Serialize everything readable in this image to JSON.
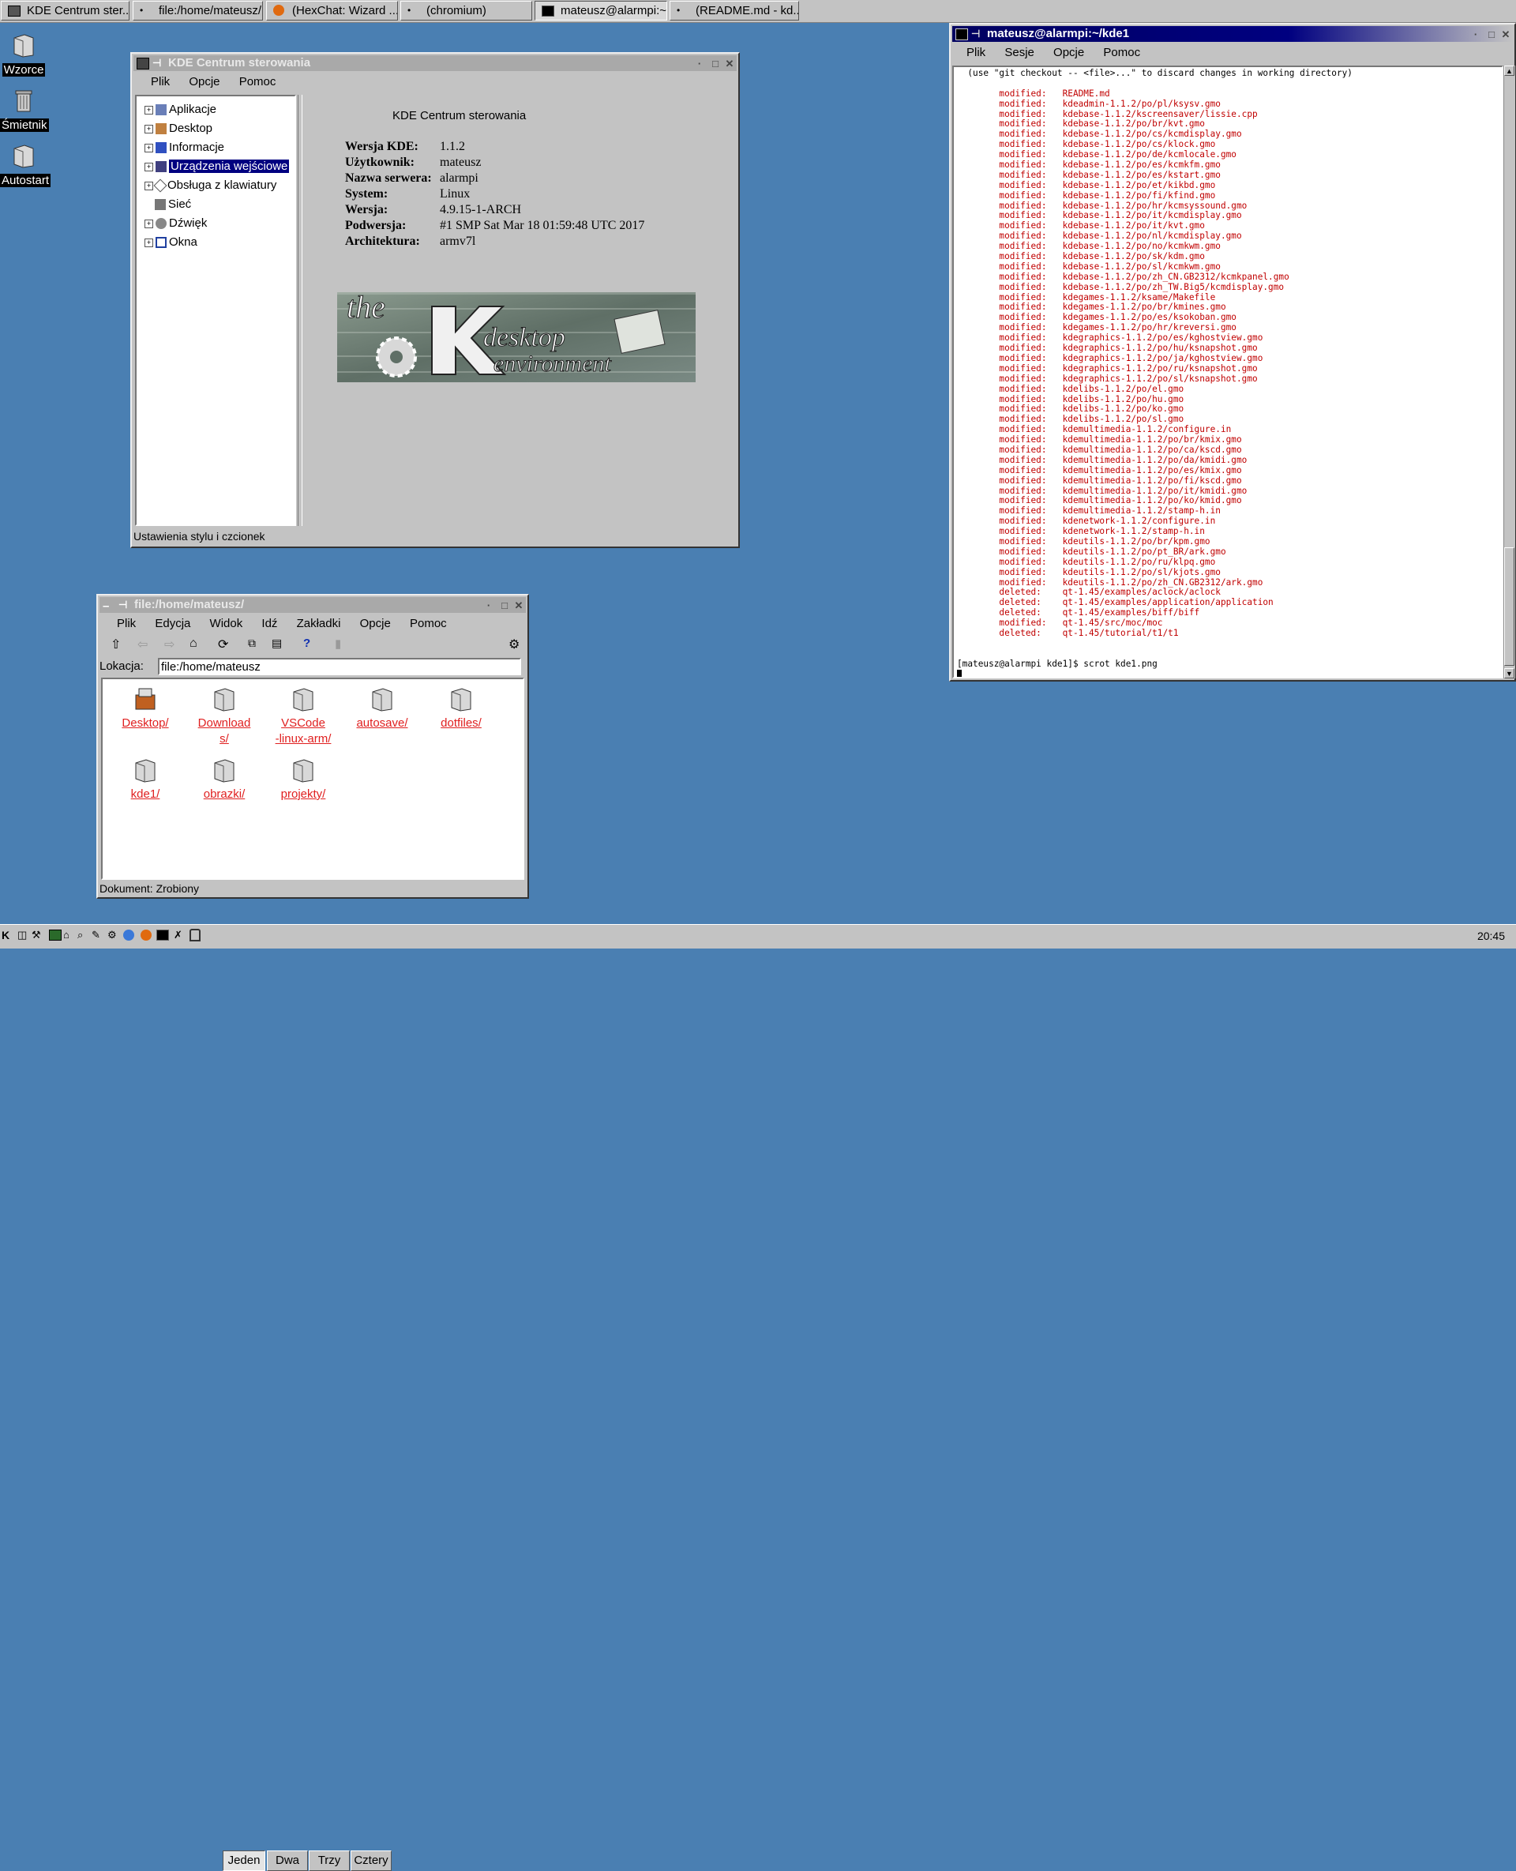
{
  "taskbar": {
    "tasks": [
      {
        "label": "KDE Centrum ster...",
        "icon": "kde-control-icon"
      },
      {
        "label": "file:/home/mateusz/",
        "icon": "dot-icon"
      },
      {
        "label": "(HexChat: Wizard ...",
        "icon": "hexchat-icon"
      },
      {
        "label": "(chromium)",
        "icon": "dot-icon"
      },
      {
        "label": "mateusz@alarmpi:~/...",
        "icon": "terminal-icon"
      },
      {
        "label": "(README.md - kd...",
        "icon": "dot-icon"
      }
    ]
  },
  "desktop_icons": [
    {
      "label": "Wzorce",
      "icon": "folder-icon"
    },
    {
      "label": "Śmietnik",
      "icon": "trash-icon"
    },
    {
      "label": "Autostart",
      "icon": "folder-icon"
    }
  ],
  "kcontrol": {
    "title": "KDE Centrum sterowania",
    "menu": [
      "Plik",
      "Opcje",
      "Pomoc"
    ],
    "tree": [
      {
        "label": "Aplikacje"
      },
      {
        "label": "Desktop"
      },
      {
        "label": "Informacje"
      },
      {
        "label": "Urządzenia wejściowe",
        "selected": true
      },
      {
        "label": "Obsługa z klawiatury"
      },
      {
        "label": "Sieć"
      },
      {
        "label": "Dźwięk"
      },
      {
        "label": "Okna"
      }
    ],
    "heading": "KDE Centrum sterowania",
    "info": [
      {
        "key": "Wersja KDE:",
        "value": "1.1.2"
      },
      {
        "key": "Użytkownik:",
        "value": "mateusz"
      },
      {
        "key": "Nazwa serwera:",
        "value": "alarmpi"
      },
      {
        "key": "System:",
        "value": "Linux"
      },
      {
        "key": "Wersja:",
        "value": "4.9.15-1-ARCH"
      },
      {
        "key": "Podwersja:",
        "value": "#1 SMP Sat Mar 18 01:59:48 UTC 2017"
      },
      {
        "key": "Architektura:",
        "value": "armv7l"
      }
    ],
    "banner": {
      "the": "the",
      "k": "K",
      "desktop": "desktop",
      "environment": "environment"
    },
    "status": "Ustawienia stylu i czcionek"
  },
  "filemanager": {
    "title": "file:/home/mateusz/",
    "menu": [
      "Plik",
      "Edycja",
      "Widok",
      "Idź",
      "Zakładki",
      "Opcje",
      "Pomoc"
    ],
    "location_label": "Lokacja:",
    "location_value": "file:/home/mateusz",
    "items": [
      {
        "label": "Desktop/"
      },
      {
        "label": "Download\ns/"
      },
      {
        "label": "VSCode\n-linux-arm/"
      },
      {
        "label": "autosave/"
      },
      {
        "label": "dotfiles/"
      },
      {
        "label": "kde1/"
      },
      {
        "label": "obrazki/"
      },
      {
        "label": "projekty/"
      }
    ],
    "status": "Dokument: Zrobiony"
  },
  "terminal": {
    "title": "mateusz@alarmpi:~/kde1",
    "menu": [
      "Plik",
      "Sesje",
      "Opcje",
      "Pomoc"
    ],
    "header_line": "  (use \"git checkout -- <file>...\" to discard changes in working directory)",
    "lines": [
      "        modified:   README.md",
      "        modified:   kdeadmin-1.1.2/po/pl/ksysv.gmo",
      "        modified:   kdebase-1.1.2/kscreensaver/lissie.cpp",
      "        modified:   kdebase-1.1.2/po/br/kvt.gmo",
      "        modified:   kdebase-1.1.2/po/cs/kcmdisplay.gmo",
      "        modified:   kdebase-1.1.2/po/cs/klock.gmo",
      "        modified:   kdebase-1.1.2/po/de/kcmlocale.gmo",
      "        modified:   kdebase-1.1.2/po/es/kcmkfm.gmo",
      "        modified:   kdebase-1.1.2/po/es/kstart.gmo",
      "        modified:   kdebase-1.1.2/po/et/kikbd.gmo",
      "        modified:   kdebase-1.1.2/po/fi/kfind.gmo",
      "        modified:   kdebase-1.1.2/po/hr/kcmsyssound.gmo",
      "        modified:   kdebase-1.1.2/po/it/kcmdisplay.gmo",
      "        modified:   kdebase-1.1.2/po/it/kvt.gmo",
      "        modified:   kdebase-1.1.2/po/nl/kcmdisplay.gmo",
      "        modified:   kdebase-1.1.2/po/no/kcmkwm.gmo",
      "        modified:   kdebase-1.1.2/po/sk/kdm.gmo",
      "        modified:   kdebase-1.1.2/po/sl/kcmkwm.gmo",
      "        modified:   kdebase-1.1.2/po/zh_CN.GB2312/kcmkpanel.gmo",
      "        modified:   kdebase-1.1.2/po/zh_TW.Big5/kcmdisplay.gmo",
      "        modified:   kdegames-1.1.2/ksame/Makefile",
      "        modified:   kdegames-1.1.2/po/br/kmines.gmo",
      "        modified:   kdegames-1.1.2/po/es/ksokoban.gmo",
      "        modified:   kdegames-1.1.2/po/hr/kreversi.gmo",
      "        modified:   kdegraphics-1.1.2/po/es/kghostview.gmo",
      "        modified:   kdegraphics-1.1.2/po/hu/ksnapshot.gmo",
      "        modified:   kdegraphics-1.1.2/po/ja/kghostview.gmo",
      "        modified:   kdegraphics-1.1.2/po/ru/ksnapshot.gmo",
      "        modified:   kdegraphics-1.1.2/po/sl/ksnapshot.gmo",
      "        modified:   kdelibs-1.1.2/po/el.gmo",
      "        modified:   kdelibs-1.1.2/po/hu.gmo",
      "        modified:   kdelibs-1.1.2/po/ko.gmo",
      "        modified:   kdelibs-1.1.2/po/sl.gmo",
      "        modified:   kdemultimedia-1.1.2/configure.in",
      "        modified:   kdemultimedia-1.1.2/po/br/kmix.gmo",
      "        modified:   kdemultimedia-1.1.2/po/ca/kscd.gmo",
      "        modified:   kdemultimedia-1.1.2/po/da/kmidi.gmo",
      "        modified:   kdemultimedia-1.1.2/po/es/kmix.gmo",
      "        modified:   kdemultimedia-1.1.2/po/fi/kscd.gmo",
      "        modified:   kdemultimedia-1.1.2/po/it/kmidi.gmo",
      "        modified:   kdemultimedia-1.1.2/po/ko/kmid.gmo",
      "        modified:   kdemultimedia-1.1.2/stamp-h.in",
      "        modified:   kdenetwork-1.1.2/configure.in",
      "        modified:   kdenetwork-1.1.2/stamp-h.in",
      "        modified:   kdeutils-1.1.2/po/br/kpm.gmo",
      "        modified:   kdeutils-1.1.2/po/pt_BR/ark.gmo",
      "        modified:   kdeutils-1.1.2/po/ru/klpq.gmo",
      "        modified:   kdeutils-1.1.2/po/sl/kjots.gmo",
      "        modified:   kdeutils-1.1.2/po/zh_CN.GB2312/ark.gmo",
      "        deleted:    qt-1.45/examples/aclock/aclock",
      "        deleted:    qt-1.45/examples/application/application",
      "        deleted:    qt-1.45/examples/biff/biff",
      "        modified:   qt-1.45/src/moc/moc",
      "        deleted:    qt-1.45/tutorial/t1/t1"
    ],
    "prompt": "[mateusz@alarmpi kde1]$ scrot kde1.png"
  },
  "panel": {
    "desktops": [
      "Jeden",
      "Dwa",
      "Trzy",
      "Cztery"
    ],
    "active_desktop": "Jeden",
    "clock": "20:45"
  }
}
